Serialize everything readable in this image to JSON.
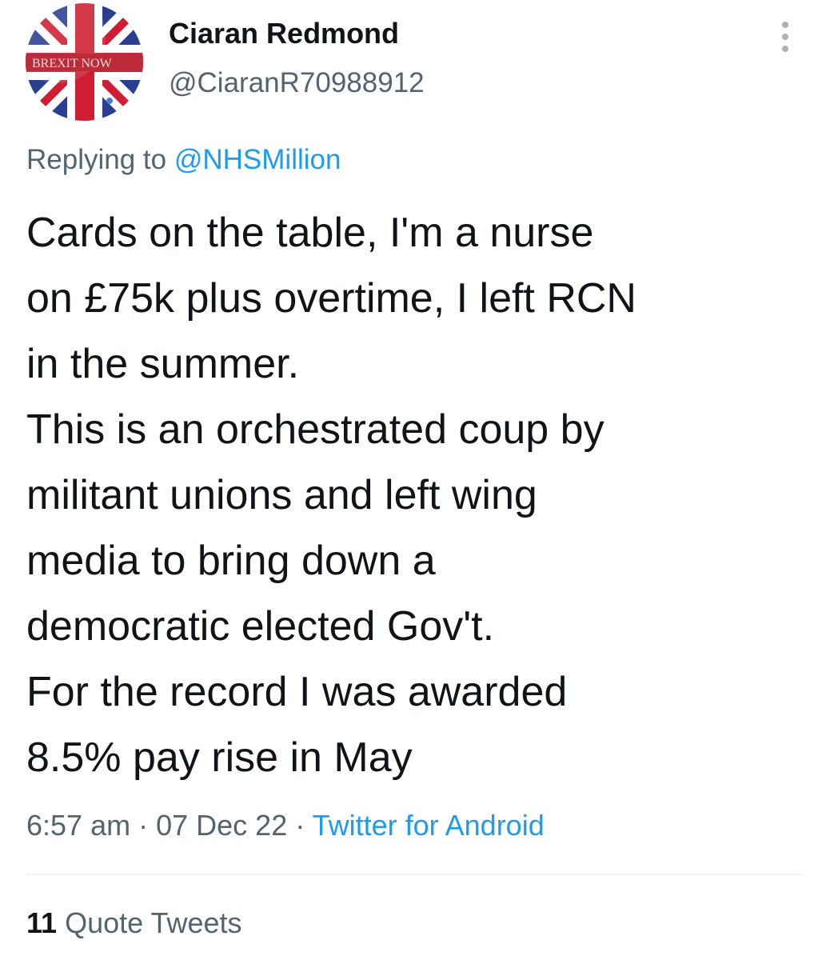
{
  "author": {
    "name": "Ciaran Redmond",
    "handle": "@CiaranR70988912",
    "avatar_banner_text": "BREXIT NOW",
    "avatar_icon": "union-jack-flag"
  },
  "more_icon": "vertical-ellipsis-icon",
  "reply": {
    "prefix": "Replying to",
    "handle": "@NHSMillion"
  },
  "text_lines": [
    "Cards on the table, I'm a nurse",
    "on £75k plus overtime, I left RCN",
    "in the summer.",
    "This is an orchestrated coup by",
    "militant unions and left wing",
    "media to bring down a",
    "democratic elected Gov't.",
    "For the record I was awarded",
    "8.5% pay rise in May"
  ],
  "meta": {
    "time": "6:57 am",
    "separator": "·",
    "date": "07 Dec 22",
    "source": "Twitter for Android"
  },
  "stats": {
    "quote_count": "11",
    "quote_label": "Quote Tweets"
  },
  "colors": {
    "text": "#0f1419",
    "secondary": "#536471",
    "link": "#1d9bf0",
    "divider": "#eff3f4"
  }
}
